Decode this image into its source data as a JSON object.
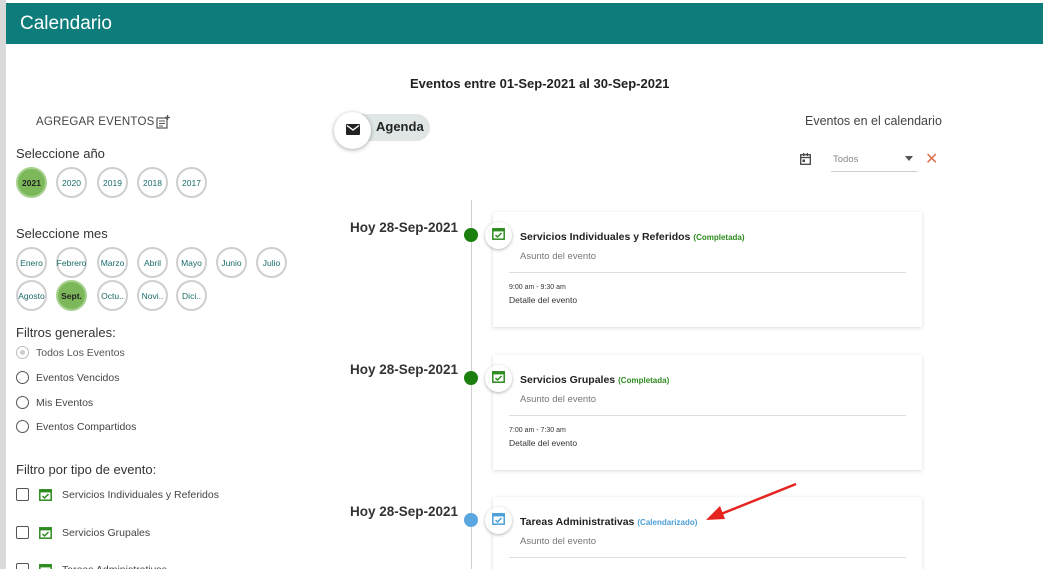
{
  "app": {
    "title": "Calendario"
  },
  "header": {
    "range_title": "Eventos entre 01-Sep-2021 al 30-Sep-2021"
  },
  "left_panel": {
    "add_events_label": "AGREGAR EVENTOS",
    "year_label": "Seleccione año",
    "years": [
      {
        "label": "2021",
        "active": true
      },
      {
        "label": "2020",
        "active": false
      },
      {
        "label": "2019",
        "active": false
      },
      {
        "label": "2018",
        "active": false
      },
      {
        "label": "2017",
        "active": false
      }
    ],
    "month_label": "Seleccione mes",
    "months": [
      {
        "label": "Enero",
        "active": false
      },
      {
        "label": "Febrero",
        "active": false
      },
      {
        "label": "Marzo",
        "active": false
      },
      {
        "label": "Abril",
        "active": false
      },
      {
        "label": "Mayo",
        "active": false
      },
      {
        "label": "Junio",
        "active": false
      },
      {
        "label": "Julio",
        "active": false
      },
      {
        "label": "Agosto",
        "active": false
      },
      {
        "label": "Sept.",
        "active": true
      },
      {
        "label": "Octu..",
        "active": false
      },
      {
        "label": "Novi..",
        "active": false
      },
      {
        "label": "Dici..",
        "active": false
      }
    ],
    "general_filters_label": "Filtros generales:",
    "general_filters": [
      {
        "label": "Todos Los Eventos",
        "checked": true
      },
      {
        "label": "Eventos Vencidos",
        "checked": false
      },
      {
        "label": "Mis Eventos",
        "checked": false
      },
      {
        "label": "Eventos Compartidos",
        "checked": false
      }
    ],
    "type_filter_label": "Filtro por tipo de evento:",
    "type_filters": [
      {
        "label": "Servicios Individuales y Referidos"
      },
      {
        "label": "Servicios Grupales"
      },
      {
        "label": "Tareas Administrativas"
      }
    ]
  },
  "agenda": {
    "label": "Agenda",
    "icon": "envelope-icon"
  },
  "right_filter": {
    "label": "Eventos en el calendario",
    "select_value": "Todos",
    "clear_icon": "close-icon"
  },
  "events": [
    {
      "date": "Hoy 28-Sep-2021",
      "title": "Servicios Individuales y Referidos",
      "status": "(Completada)",
      "status_color": "#2e8b1f",
      "dot_color": "#1a7f0e",
      "icon_color": "#2e8b1f",
      "subject": "Asunto del evento",
      "time": "9:00 am - 9:30 am",
      "detail": "Detalle del evento"
    },
    {
      "date": "Hoy 28-Sep-2021",
      "title": "Servicios Grupales",
      "status": "(Completada)",
      "status_color": "#2e8b1f",
      "dot_color": "#1a7f0e",
      "icon_color": "#2e8b1f",
      "subject": "Asunto del evento",
      "time": "7:00 am - 7:30 am",
      "detail": "Detalle del evento"
    },
    {
      "date": "Hoy 28-Sep-2021",
      "title": "Tareas Administrativas",
      "status": "(Calendarizado)",
      "status_color": "#4a9fd8",
      "dot_color": "#5aa7e0",
      "icon_color": "#4a9fd8",
      "subject": "Asunto del evento",
      "time": "",
      "detail": ""
    }
  ],
  "colors": {
    "appbar": "#0e7c7b",
    "active_chip": "#7cb85a",
    "annotation_arrow": "#e52420"
  }
}
